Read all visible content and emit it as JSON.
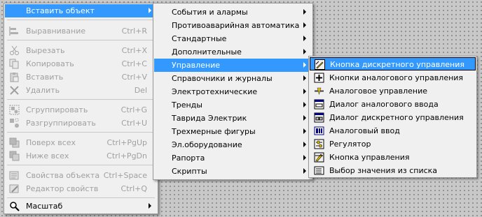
{
  "menu1": {
    "items": [
      {
        "label": "Вставить объект",
        "shortcut": "",
        "icon": "",
        "submenu": true,
        "disabled": false,
        "highlighted": true
      },
      {
        "label": "Выравнивание",
        "shortcut": "Ctrl+R",
        "icon": "align-icon",
        "submenu": false,
        "disabled": true
      },
      {
        "label": "Вырезать",
        "shortcut": "Ctrl+X",
        "icon": "cut-icon",
        "submenu": false,
        "disabled": true
      },
      {
        "label": "Копировать",
        "shortcut": "Ctrl+C",
        "icon": "copy-icon",
        "submenu": false,
        "disabled": true
      },
      {
        "label": "Вставить",
        "shortcut": "Ctrl+V",
        "icon": "paste-icon",
        "submenu": false,
        "disabled": true
      },
      {
        "label": "Удалить",
        "shortcut": "Del",
        "icon": "delete-icon",
        "submenu": false,
        "disabled": true
      },
      {
        "label": "Сгруппировать",
        "shortcut": "Ctrl+G",
        "icon": "group-icon",
        "submenu": false,
        "disabled": true
      },
      {
        "label": "Разгруппировать",
        "shortcut": "Ctrl+U",
        "icon": "ungroup-icon",
        "submenu": false,
        "disabled": true
      },
      {
        "label": "Поверх всех",
        "shortcut": "Ctrl+PgUp",
        "icon": "bring-to-front-icon",
        "submenu": false,
        "disabled": true
      },
      {
        "label": "Ниже всех",
        "shortcut": "Ctrl+PgDn",
        "icon": "send-to-back-icon",
        "submenu": false,
        "disabled": true
      },
      {
        "label": "Свойства объекта",
        "shortcut": "Ctrl+Space",
        "icon": "properties-icon",
        "submenu": false,
        "disabled": true
      },
      {
        "label": "Редактор свойств",
        "shortcut": "Ctrl+Q",
        "icon": "property-editor-icon",
        "submenu": false,
        "disabled": true
      },
      {
        "label": "Масштаб",
        "shortcut": "",
        "icon": "zoom-icon",
        "submenu": true,
        "disabled": false
      }
    ]
  },
  "menu2": {
    "items": [
      {
        "label": "События и алармы"
      },
      {
        "label": "Противоаварийная автоматика"
      },
      {
        "label": "Стандартные"
      },
      {
        "label": "Дополнительные"
      },
      {
        "label": "Управление",
        "highlighted": true
      },
      {
        "label": "Справочники и журналы"
      },
      {
        "label": "Электротехнические"
      },
      {
        "label": "Тренды"
      },
      {
        "label": "Таврида Электрик"
      },
      {
        "label": "Трехмерные фигуры"
      },
      {
        "label": "Эл.оборудование"
      },
      {
        "label": "Рапорта"
      },
      {
        "label": "Скрипты"
      }
    ]
  },
  "menu3": {
    "items": [
      {
        "label": "Кнопка дискретного управления",
        "icon": "discrete-button-icon",
        "highlighted": true
      },
      {
        "label": "Кнопки аналогового управления",
        "icon": "analog-buttons-icon"
      },
      {
        "label": "Аналоговое управление",
        "icon": "analog-control-icon"
      },
      {
        "label": "Диалог аналогового ввода",
        "icon": "analog-input-dialog-icon"
      },
      {
        "label": "Диалог дискретного управления",
        "icon": "discrete-dialog-icon"
      },
      {
        "label": "Аналоговый ввод",
        "icon": "analog-input-icon"
      },
      {
        "label": "Регулятор",
        "icon": "regulator-icon"
      },
      {
        "label": "Кнопка управления",
        "icon": "control-button-icon"
      },
      {
        "label": "Выбор значения из списка",
        "icon": "list-select-icon"
      }
    ]
  }
}
